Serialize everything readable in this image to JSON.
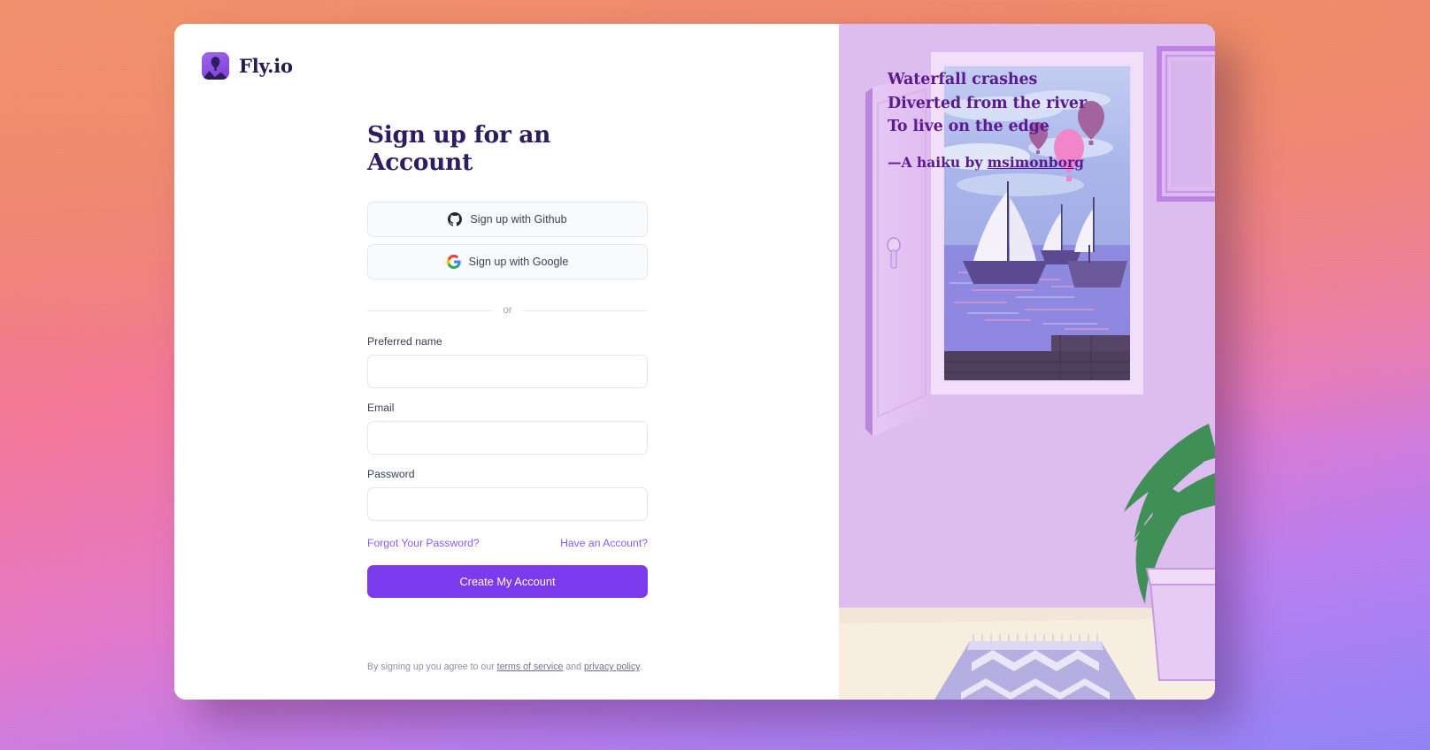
{
  "brand": {
    "name": "Fly.io",
    "logo_icon": "balloon-logo-icon",
    "logo_color": "#7b3ddd"
  },
  "form": {
    "title": "Sign up for an Account",
    "oauth": [
      {
        "label": "Sign up with Github",
        "icon": "github-icon"
      },
      {
        "label": "Sign up with Google",
        "icon": "google-icon"
      }
    ],
    "divider_label": "or",
    "fields": [
      {
        "label": "Preferred name",
        "value": "",
        "placeholder": ""
      },
      {
        "label": "Email",
        "value": "",
        "placeholder": ""
      },
      {
        "label": "Password",
        "value": "",
        "placeholder": ""
      }
    ],
    "forgot_password_link": "Forgot Your Password?",
    "have_account_link": "Have an Account?",
    "submit_label": "Create My Account",
    "accent_color": "#7c3aed",
    "link_color": "#8b5cf6"
  },
  "legal": {
    "prefix": "By signing up you agree to our ",
    "terms_link": "terms of service",
    "middle": " and ",
    "privacy_link": "privacy policy",
    "suffix": "."
  },
  "art": {
    "haiku": [
      "Waterfall crashes",
      "Diverted from the river",
      "To live on the edge"
    ],
    "credit_prefix": "—A haiku by ",
    "credit_author": "msimonborg",
    "text_color": "#5b1a8f",
    "panel_color": "#ddbdf0",
    "illustration": "open-door-seascape-illustration"
  },
  "background": {
    "gradient_from": "#ef8e67",
    "gradient_mid": "#f2779a",
    "gradient_to": "#8f83f5"
  }
}
